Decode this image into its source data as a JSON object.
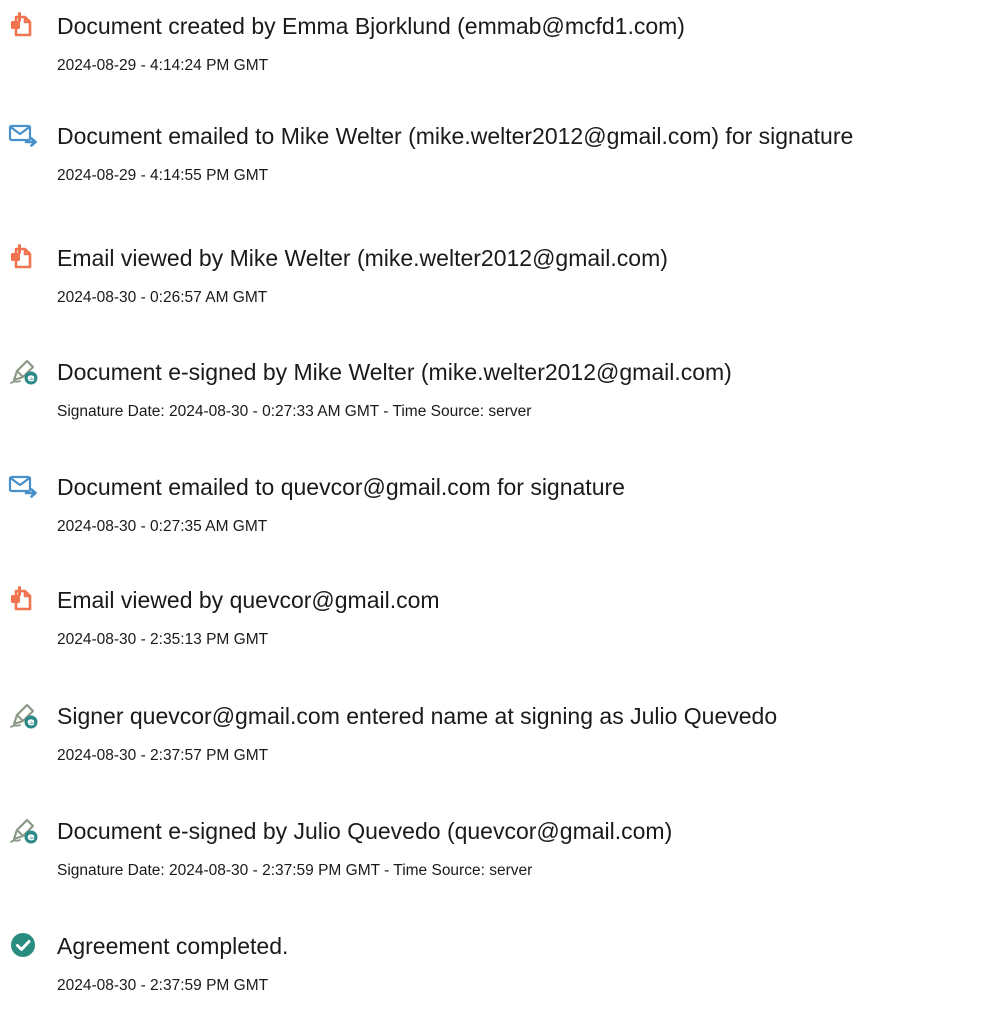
{
  "colors": {
    "document_icon": "#f0744f",
    "email_icon": "#4a90c8",
    "esign_pen": "#8a9a86",
    "esign_badge": "#2b8a88",
    "complete_icon": "#2a8c7f"
  },
  "events": [
    {
      "icon": "document-icon",
      "title": "Document created by Emma Bjorklund (emmab@mcfd1.com)",
      "detail": "2024-08-29 - 4:14:24 PM GMT"
    },
    {
      "icon": "email-icon",
      "title": "Document emailed to Mike Welter (mike.welter2012@gmail.com) for signature",
      "detail": "2024-08-29 - 4:14:55 PM GMT"
    },
    {
      "icon": "document-icon",
      "title": "Email viewed by Mike Welter (mike.welter2012@gmail.com)",
      "detail": "2024-08-30 - 0:26:57 AM GMT"
    },
    {
      "icon": "esign-icon",
      "title": "Document e-signed by Mike Welter (mike.welter2012@gmail.com)",
      "detail": "Signature Date: 2024-08-30 - 0:27:33 AM GMT - Time Source: server"
    },
    {
      "icon": "email-icon",
      "title": "Document emailed to quevcor@gmail.com for signature",
      "detail": "2024-08-30 - 0:27:35 AM GMT"
    },
    {
      "icon": "document-icon",
      "title": "Email viewed by quevcor@gmail.com",
      "detail": "2024-08-30 - 2:35:13 PM GMT"
    },
    {
      "icon": "esign-icon",
      "title": "Signer quevcor@gmail.com entered name at signing as Julio Quevedo",
      "detail": "2024-08-30 - 2:37:57 PM GMT"
    },
    {
      "icon": "esign-icon",
      "title": "Document e-signed by Julio Quevedo (quevcor@gmail.com)",
      "detail": "Signature Date: 2024-08-30 - 2:37:59 PM GMT - Time Source: server"
    },
    {
      "icon": "check-circle-icon",
      "title": "Agreement completed.",
      "detail": "2024-08-30 - 2:37:59 PM GMT"
    }
  ]
}
